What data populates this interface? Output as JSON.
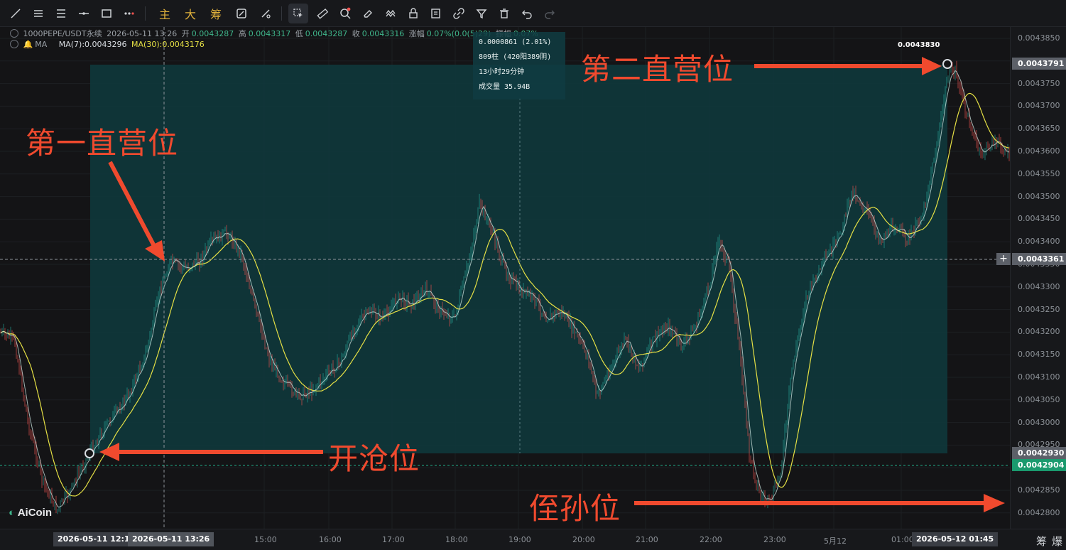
{
  "toolbar": {
    "text_buttons": [
      "主",
      "大",
      "筹"
    ]
  },
  "header": {
    "symbol": "1000PEPE/USDT永续",
    "datetime": "2026-05-11 13:26",
    "open_label": "开",
    "open": "0.0043287",
    "high_label": "高",
    "high": "0.0043317",
    "low_label": "低",
    "low": "0.0043287",
    "close_label": "收",
    "close": "0.0043316",
    "change_label": "涨幅",
    "change": "0.07%(0.0(5)29)",
    "amp_label": "振幅",
    "amp": "0.07%",
    "ma_label": "MA",
    "ma7": "MA(7):0.0043296",
    "ma30": "MA(30):0.0043176"
  },
  "measure": {
    "line1": "0.0000861 (2.01%)",
    "line2": "809柱 (420阳389阴)",
    "line3": "13小时29分钟",
    "line4": "成交量 35.94B"
  },
  "annotations": {
    "first": "第一直营位",
    "second": "第二直营位",
    "open": "开沧位",
    "stop": "侄孙位",
    "peak_label": "0.0043830"
  },
  "price_axis": {
    "labels": [
      "0.0043850",
      "0.0043800",
      "0.0043750",
      "0.0043700",
      "0.0043650",
      "0.0043600",
      "0.0043550",
      "0.0043500",
      "0.0043450",
      "0.0043400",
      "0.0043350",
      "0.0043300",
      "0.0043250",
      "0.0043200",
      "0.0043150",
      "0.0043100",
      "0.0043050",
      "0.0043000",
      "0.0042950",
      "0.0042900",
      "0.0042850",
      "0.0042800"
    ],
    "tag_high": "0.0043791",
    "tag_cross": "0.0043361",
    "tag_low": "0.0042930",
    "tag_last": "0.0042904",
    "plus": "+"
  },
  "time_axis": {
    "labels": [
      "15:00",
      "16:00",
      "17:00",
      "18:00",
      "19:00",
      "20:00",
      "21:00",
      "22:00",
      "23:00",
      "5月12",
      "01:00"
    ],
    "tag_start": "2026-05-11 12:16",
    "tag_cursor": "2026-05-11 13:26",
    "tag_end": "2026-05-12 01:45",
    "corner_left": "筹",
    "corner_right": "爆"
  },
  "logo": "AiCoin",
  "colors": {
    "up": "#26a69a",
    "down": "#ef5350",
    "box": "#0e3a3d",
    "ma30": "#e5e045",
    "annotation": "#f04a2e"
  }
}
